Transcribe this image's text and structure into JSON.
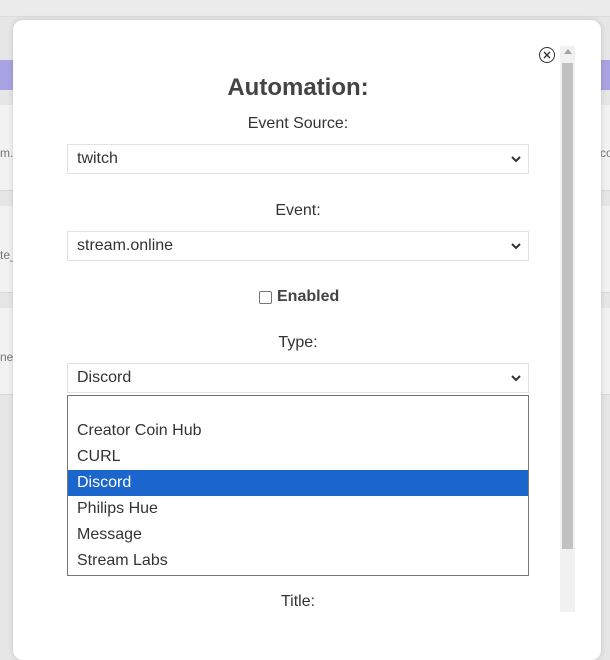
{
  "modal": {
    "title": "Automation:",
    "event_source": {
      "label": "Event Source:",
      "value": "twitch"
    },
    "event": {
      "label": "Event:",
      "value": "stream.online"
    },
    "enabled": {
      "label": "Enabled",
      "checked": false
    },
    "type": {
      "label": "Type:",
      "value": "Discord",
      "options": [
        "",
        "Creator Coin Hub",
        "CURL",
        "Discord",
        "Philips Hue",
        "Message",
        "Stream Labs"
      ],
      "highlighted": "Discord"
    },
    "title_field": {
      "label": "Title:"
    }
  },
  "background": {
    "fragments": [
      "m.c",
      "te_",
      "nel",
      "co"
    ]
  },
  "colors": {
    "highlight": "#1a66cc",
    "accent_bg": "#a8a3e3"
  }
}
